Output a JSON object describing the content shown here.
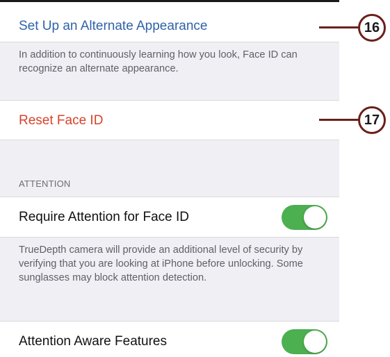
{
  "settings": {
    "alternate_appearance": {
      "label": "Set Up an Alternate Appearance",
      "footer": "In addition to continuously learning how you look, Face ID can recognize an alternate appearance."
    },
    "reset": {
      "label": "Reset Face ID"
    },
    "attention": {
      "header": "ATTENTION",
      "require_attention": {
        "label": "Require Attention for Face ID",
        "on": true,
        "footer": "TrueDepth camera will provide an additional level of security by verifying that you are looking at iPhone before unlocking. Some sunglasses may block attention detection."
      },
      "aware_features": {
        "label": "Attention Aware Features",
        "on": true
      }
    }
  },
  "callouts": [
    {
      "number": "16"
    },
    {
      "number": "17"
    }
  ],
  "colors": {
    "link_blue": "#2f63a8",
    "destructive_red": "#d8412a",
    "toggle_green": "#4caf50",
    "callout_stroke": "#6b1f1b",
    "grouped_background": "#efeff4"
  }
}
